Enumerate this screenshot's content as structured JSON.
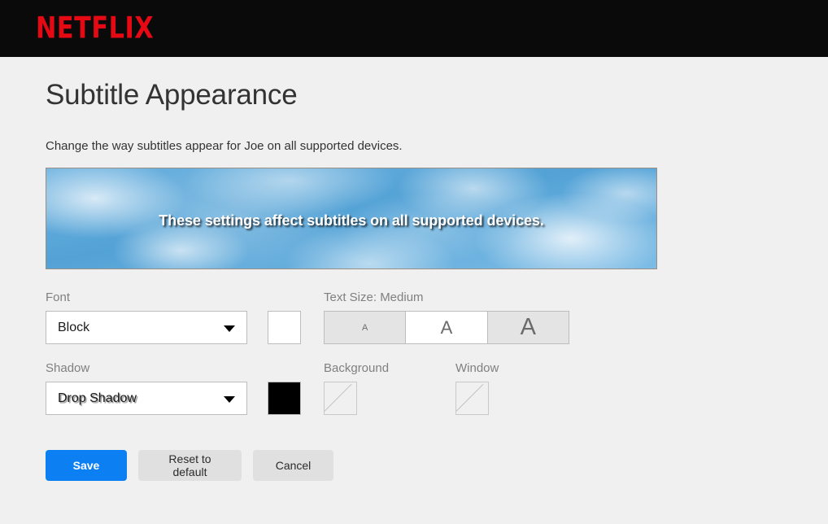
{
  "header": {
    "brand": "NETFLIX"
  },
  "main": {
    "title": "Subtitle Appearance",
    "description": "Change the way subtitles appear for Joe on all supported devices.",
    "preview_text": "These settings affect subtitles on all supported devices."
  },
  "font": {
    "label": "Font",
    "value": "Block",
    "color": "#FFFFFF"
  },
  "text_size": {
    "label": "Text Size: Medium",
    "selected": "Medium",
    "options": [
      {
        "key": "small",
        "glyph": "A"
      },
      {
        "key": "medium",
        "glyph": "A"
      },
      {
        "key": "large",
        "glyph": "A"
      }
    ]
  },
  "shadow": {
    "label": "Shadow",
    "value": "Drop Shadow",
    "color": "#000000"
  },
  "background": {
    "label": "Background",
    "color": "none"
  },
  "window": {
    "label": "Window",
    "color": "none"
  },
  "buttons": {
    "save": "Save",
    "reset": "Reset to default",
    "cancel": "Cancel"
  },
  "colors": {
    "header_bg": "#0A0A0A",
    "brand": "#E50914",
    "page_bg": "#F0F0F0",
    "primary": "#0C7FF2",
    "secondary": "#E0E0E0"
  }
}
